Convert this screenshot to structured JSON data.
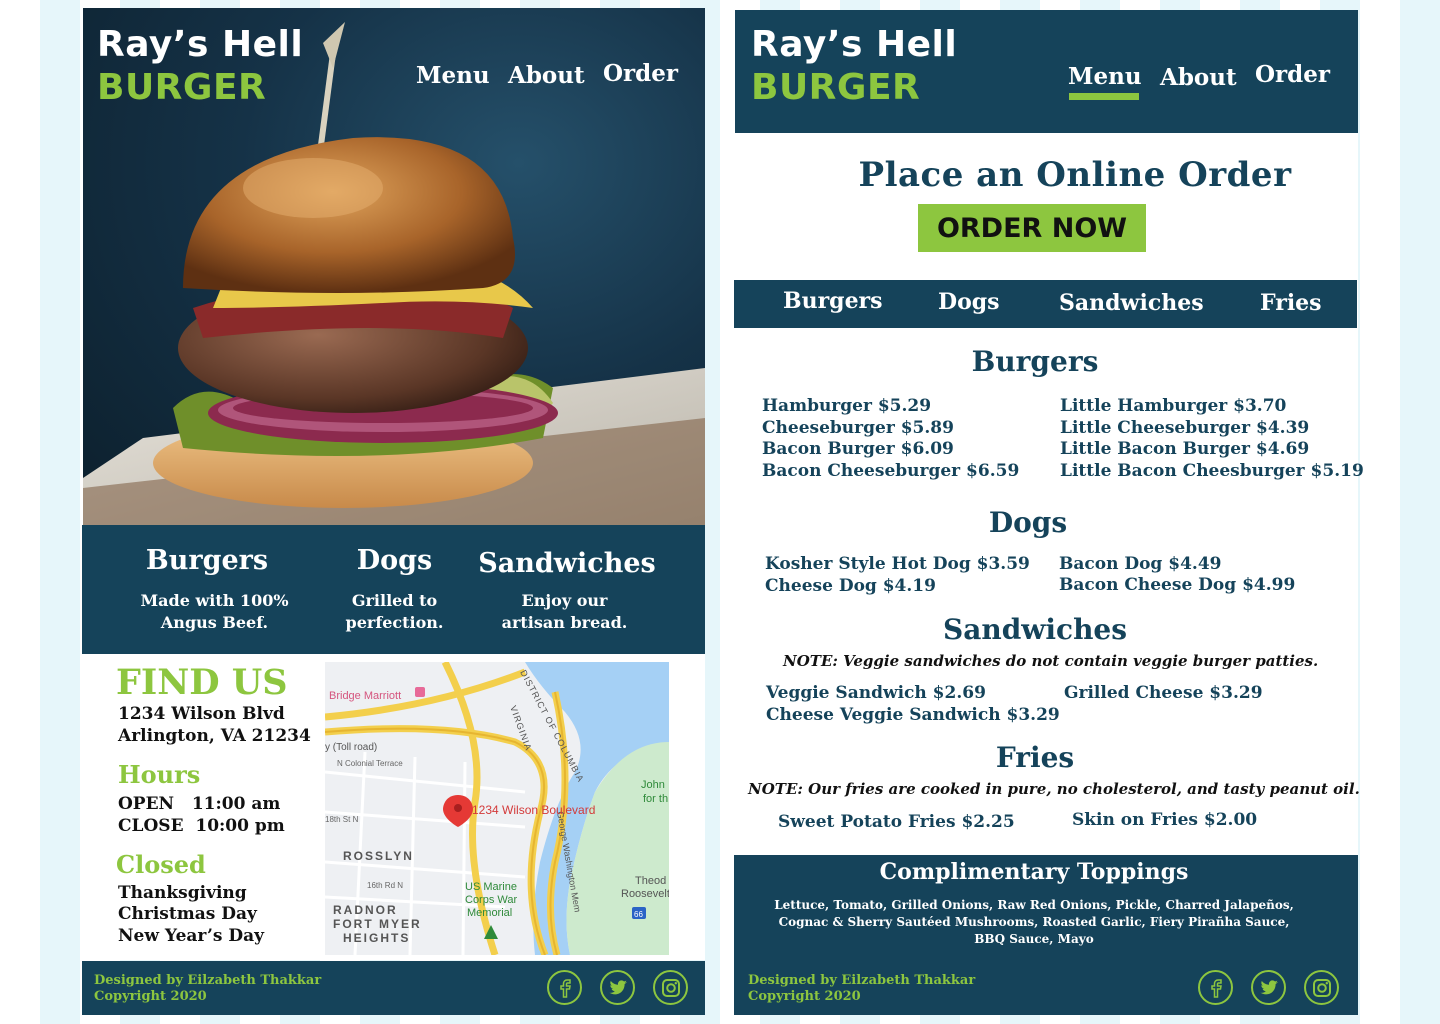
{
  "brand": {
    "name_line1": "Ray’s Hell",
    "name_line2": "BURGER"
  },
  "nav": {
    "menu": "Menu",
    "about": "About",
    "order": "Order"
  },
  "features": [
    {
      "title": "Burgers",
      "desc1": "Made with 100%",
      "desc2": "Angus Beef."
    },
    {
      "title": "Dogs",
      "desc1": "Grilled to",
      "desc2": "perfection."
    },
    {
      "title": "Sandwiches",
      "desc1": "Enjoy our",
      "desc2": "artisan bread."
    }
  ],
  "find_us": {
    "heading": "FIND US",
    "address1": "1234 Wilson Blvd",
    "address2": "Arlington, VA 21234",
    "hours_heading": "Hours",
    "open": "OPEN   11:00 am",
    "close": "CLOSE  10:00 pm",
    "closed_heading": "Closed",
    "closed_days": [
      "Thanksgiving",
      "Christmas Day",
      "New Year’s Day"
    ]
  },
  "map": {
    "pin_label": "1234 Wilson Boulevard",
    "labels": {
      "hotel": "Bridge Marriott",
      "toll": "y (Toll road)",
      "colonial": "N Colonial Terrace",
      "district": "DISTRICT OF COLUMBIA",
      "virginia": "VIRGINIA",
      "st18": "18th St N",
      "rosslyn": "ROSSLYN",
      "st16": "16th Rd N",
      "radnor": "RADNOR",
      "fortmyer": "FORT MYER",
      "heights": "HEIGHTS",
      "marine1": "US Marine",
      "marine2": "Corps War",
      "marine3": "Memorial",
      "gw": "George Washington Mem",
      "john1": "John",
      "john2": "for th",
      "theod1": "Theod",
      "theod2": "Roosevelt Bric",
      "route": "66"
    }
  },
  "footer": {
    "designer": "Designed by Eilzabeth Thakkar",
    "copyright": "Copyright 2020"
  },
  "order": {
    "heading": "Place an Online Order",
    "button": "ORDER NOW"
  },
  "tabs": [
    "Burgers",
    "Dogs",
    "Sandwiches",
    "Fries"
  ],
  "menu": {
    "burgers": {
      "title": "Burgers",
      "left": [
        "Hamburger $5.29",
        "Cheeseburger $5.89",
        "Bacon Burger $6.09",
        "Bacon Cheeseburger $6.59"
      ],
      "right": [
        "Little Hamburger $3.70",
        "Little Cheeseburger $4.39",
        "Little Bacon Burger $4.69",
        "Little Bacon Cheesburger $5.19"
      ]
    },
    "dogs": {
      "title": "Dogs",
      "left": [
        "Kosher Style Hot Dog $3.59",
        "Cheese Dog $4.19"
      ],
      "right": [
        "Bacon Dog $4.49",
        "Bacon Cheese Dog $4.99"
      ]
    },
    "sandwiches": {
      "title": "Sandwiches",
      "note": "NOTE: Veggie sandwiches do not contain veggie burger patties.",
      "left": [
        "Veggie Sandwich $2.69",
        "Cheese Veggie Sandwich $3.29"
      ],
      "right": [
        "Grilled Cheese $3.29"
      ]
    },
    "fries": {
      "title": "Fries",
      "note": "NOTE: Our fries are cooked in pure, no cholesterol, and tasty peanut oil.",
      "left": [
        "Sweet Potato Fries $2.25"
      ],
      "right": [
        "Skin on Fries $2.00"
      ]
    }
  },
  "toppings": {
    "title": "Complimentary Toppings",
    "line1": "Lettuce, Tomato, Grilled Onions, Raw Red Onions, Pickle, Charred Jalapeños,",
    "line2": "Cognac & Sherry Sautéed Mushrooms, Roasted Garlic, Fiery Pirañha Sauce,",
    "line3": "BBQ Sauce, Mayo"
  },
  "icons": [
    "facebook-icon",
    "twitter-icon",
    "instagram-icon",
    "map-pin-icon",
    "hotel-icon"
  ],
  "colors": {
    "navy": "#15435a",
    "green": "#8dc63f",
    "button_green": "#8dc63f"
  }
}
